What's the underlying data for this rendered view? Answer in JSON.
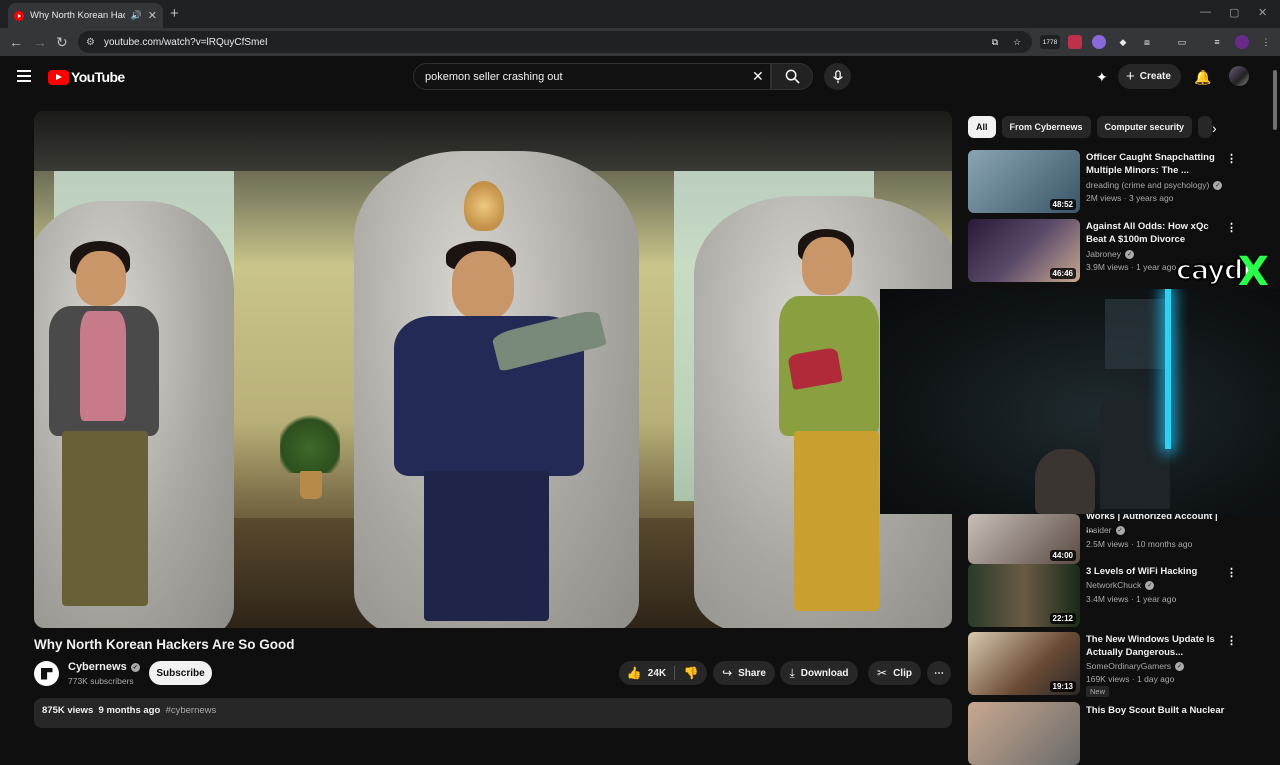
{
  "browser": {
    "tab_title": "Why North Korean Hackers",
    "url": "youtube.com/watch?v=lRQuyCfSmeI",
    "ext_badge": "1778"
  },
  "header": {
    "logo_text": "YouTube",
    "search_value": "pokemon seller crashing out",
    "create_label": "Create"
  },
  "video": {
    "title": "Why North Korean Hackers Are So Good",
    "channel": "Cybernews",
    "subscribers": "773K subscribers",
    "subscribe_label": "Subscribe",
    "likes": "24K",
    "share_label": "Share",
    "download_label": "Download",
    "clip_label": "Clip",
    "views": "875K views",
    "age": "9 months ago",
    "hashtag": "#cybernews"
  },
  "chips": [
    "All",
    "From Cybernews",
    "Computer security"
  ],
  "recommendations": [
    {
      "title": "Officer Caught Snapchatting Multiple Minors: The ...",
      "channel": "dreading (crime and psychology)",
      "meta": "2M views · 3 years ago",
      "duration": "48:52",
      "thumb_color": "#5d7a8a"
    },
    {
      "title": "Against All Odds: How xQc Beat A $100m Divorce",
      "channel": "Jabroney",
      "meta": "3.9M views · 1 year ago",
      "duration": "46:46",
      "thumb_color": "#4a3a5a"
    },
    {
      "title": "Works | Authorized Account | ...",
      "channel": "Insider",
      "meta": "2.5M views · 10 months ago",
      "duration": "44:00",
      "thumb_color": "#7a6a60"
    },
    {
      "title": "3 Levels of WiFi Hacking",
      "channel": "NetworkChuck",
      "meta": "3.4M views · 1 year ago",
      "duration": "22:12",
      "thumb_color": "#3a4a3a"
    },
    {
      "title": "The New Windows Update Is Actually Dangerous...",
      "channel": "SomeOrdinaryGamers",
      "meta": "169K views · 1 day ago",
      "duration": "19:13",
      "badge": "New",
      "thumb_color": "#6a5a4a"
    },
    {
      "title": "This Boy Scout Built a Nuclear",
      "channel": "",
      "meta": "",
      "duration": "",
      "thumb_color": "#5a5a5a"
    }
  ],
  "overlay": {
    "streamer_name": "caydr",
    "logo_mark": "X"
  },
  "colors": {
    "accent": "#ff0000",
    "bg": "#0f0f0f",
    "neon": "#2fd0f0",
    "overlay_green": "#2aff4a"
  }
}
